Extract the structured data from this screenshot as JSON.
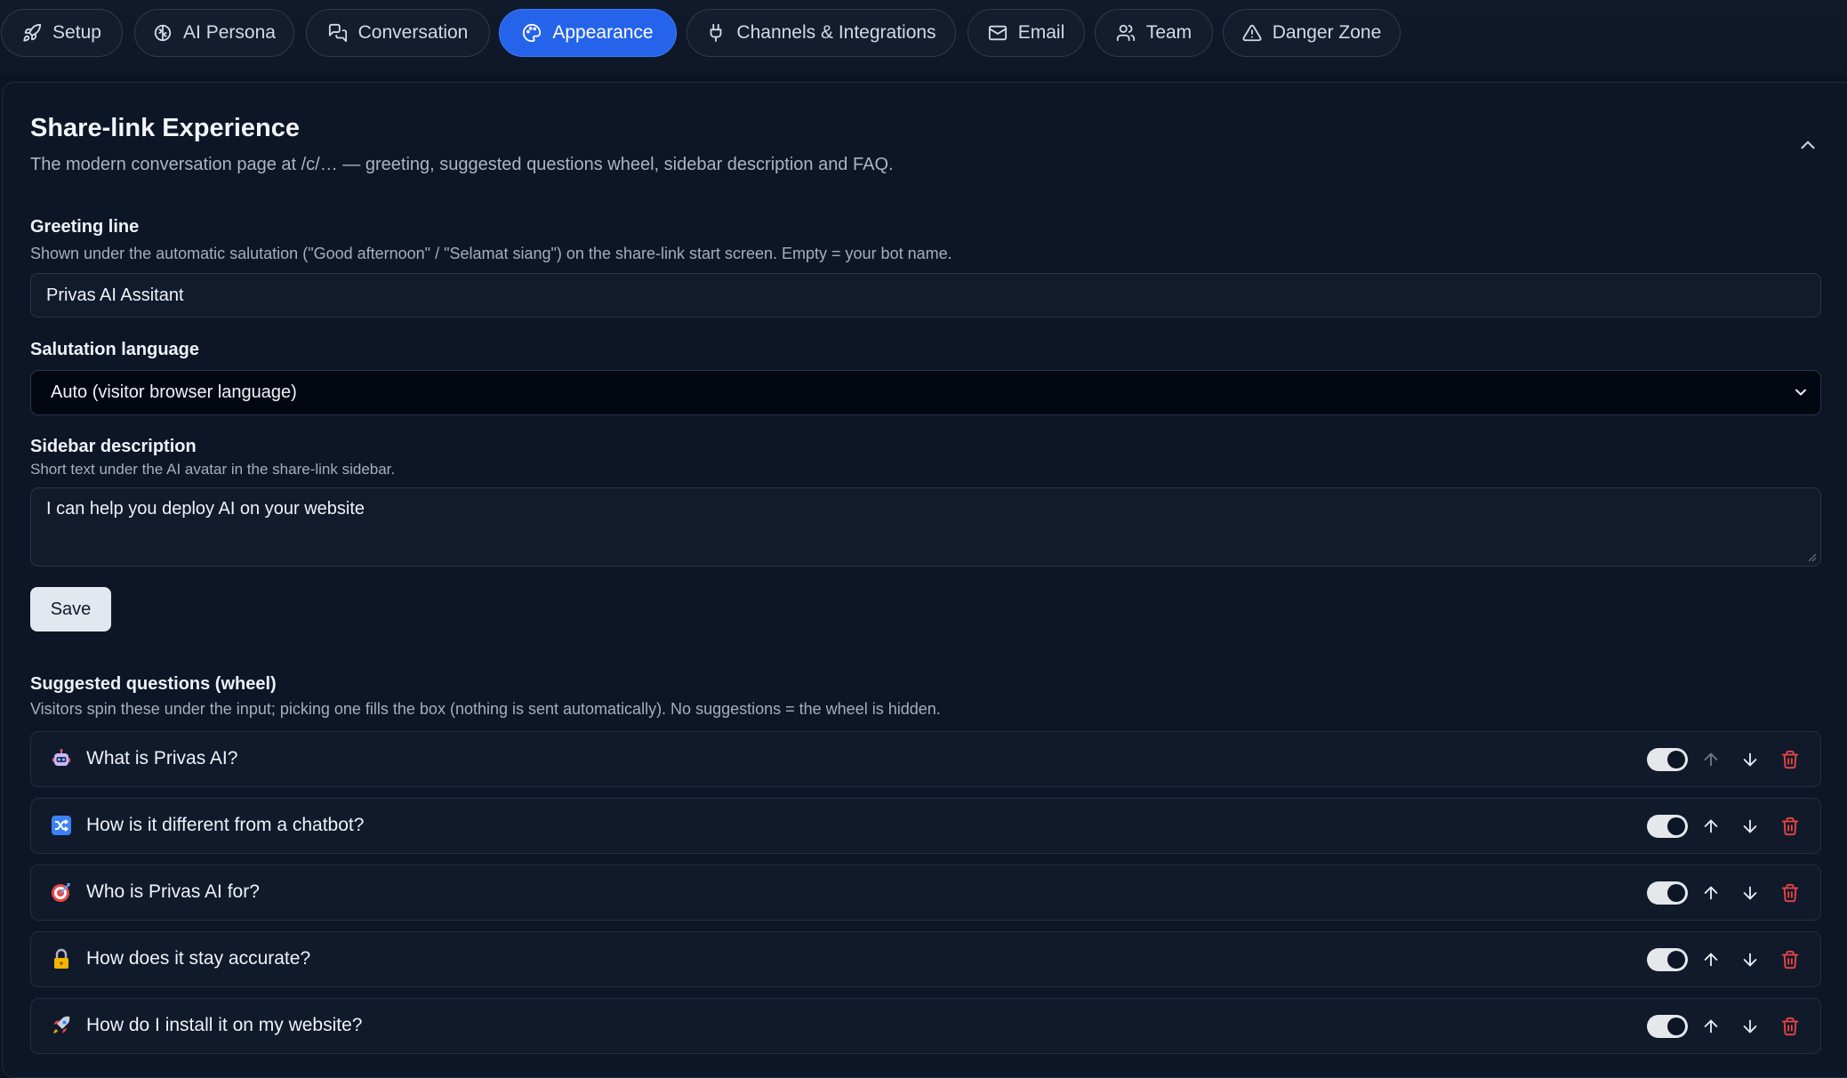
{
  "tabs": [
    {
      "label": "Setup",
      "icon": "rocket-icon",
      "active": false
    },
    {
      "label": "AI Persona",
      "icon": "brain-icon",
      "active": false
    },
    {
      "label": "Conversation",
      "icon": "chat-bubbles-icon",
      "active": false
    },
    {
      "label": "Appearance",
      "icon": "palette-icon",
      "active": true
    },
    {
      "label": "Channels & Integrations",
      "icon": "plug-icon",
      "active": false
    },
    {
      "label": "Email",
      "icon": "mail-icon",
      "active": false
    },
    {
      "label": "Team",
      "icon": "users-icon",
      "active": false
    },
    {
      "label": "Danger Zone",
      "icon": "warning-triangle-icon",
      "active": false
    }
  ],
  "section": {
    "title": "Share-link Experience",
    "subtitle": "The modern conversation page at /c/… — greeting, suggested questions wheel, sidebar description and FAQ."
  },
  "greeting": {
    "label": "Greeting line",
    "hint": "Shown under the automatic salutation (\"Good afternoon\" / \"Selamat siang\") on the share-link start screen. Empty = your bot name.",
    "value": "Privas AI Assitant"
  },
  "salutation": {
    "label": "Salutation language",
    "selected": "Auto (visitor browser language)"
  },
  "sidebar_description": {
    "label": "Sidebar description",
    "hint": "Short text under the AI avatar in the share-link sidebar.",
    "value": "I can help you deploy AI on your website"
  },
  "save_label": "Save",
  "suggestions": {
    "label": "Suggested questions (wheel)",
    "hint": "Visitors spin these under the input; picking one fills the box (nothing is sent automatically). No suggestions = the wheel is hidden.",
    "items": [
      {
        "text": "What is Privas AI?",
        "icon": "robot-emoji",
        "enabled": true,
        "up_enabled": false
      },
      {
        "text": "How is it different from a chatbot?",
        "icon": "shuffle-emoji",
        "enabled": true,
        "up_enabled": true
      },
      {
        "text": "Who is Privas AI for?",
        "icon": "target-emoji",
        "enabled": true,
        "up_enabled": true
      },
      {
        "text": "How does it stay accurate?",
        "icon": "lock-emoji",
        "enabled": true,
        "up_enabled": true
      },
      {
        "text": "How do I install it on my website?",
        "icon": "rocket-emoji",
        "enabled": true,
        "up_enabled": true
      }
    ]
  },
  "colors": {
    "background": "#0c1424",
    "accent": "#2563eb",
    "delete": "#ef4444"
  }
}
